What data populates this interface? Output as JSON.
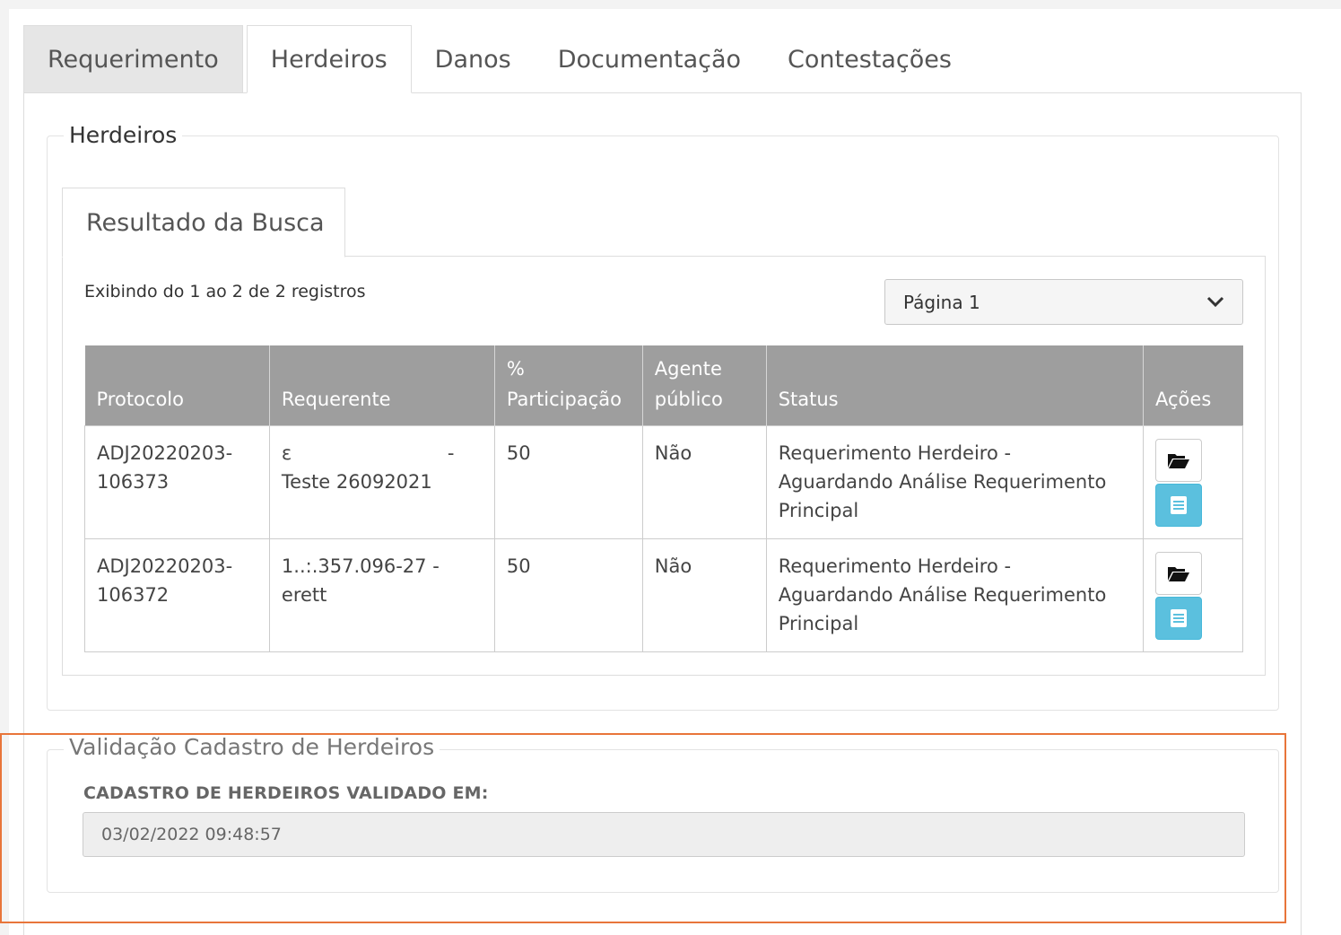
{
  "tabs": [
    {
      "label": "Requerimento"
    },
    {
      "label": "Herdeiros"
    },
    {
      "label": "Danos"
    },
    {
      "label": "Documentação"
    },
    {
      "label": "Contestações"
    }
  ],
  "active_tab": "Herdeiros",
  "herdeiros_section": {
    "legend": "Herdeiros",
    "subtab_label": "Resultado da Busca",
    "records_info": "Exibindo do 1 ao 2 de 2 registros",
    "page_select": {
      "selected": "Página 1"
    },
    "columns": [
      {
        "line1": "",
        "line2": "Protocolo"
      },
      {
        "line1": "",
        "line2": "Requerente"
      },
      {
        "line1": "%",
        "line2": "Participação"
      },
      {
        "line1": "Agente",
        "line2": "público"
      },
      {
        "line1": "",
        "line2": "Status"
      },
      {
        "line1": "",
        "line2": "Ações"
      }
    ],
    "rows": [
      {
        "protocolo": [
          "ADJ20220203-",
          "106373"
        ],
        "requerente": [
          "ε                          -",
          "Teste 26092021"
        ],
        "participacao": "50",
        "agente_publico": "Não",
        "status": [
          "Requerimento Herdeiro -",
          "Aguardando Análise Requerimento",
          "Principal"
        ]
      },
      {
        "protocolo": [
          "ADJ20220203-",
          "106372"
        ],
        "requerente": [
          "1..:.357.096-27 -",
          "erett"
        ],
        "participacao": "50",
        "agente_publico": "Não",
        "status": [
          "Requerimento Herdeiro -",
          "Aguardando Análise Requerimento",
          "Principal"
        ]
      }
    ],
    "action_icons": [
      "folder-open-icon",
      "list-detail-icon"
    ]
  },
  "validacao_section": {
    "legend": "Validação Cadastro de Herdeiros",
    "field_label": "CADASTRO DE HERDEIROS VALIDADO EM:",
    "field_value": "03/02/2022 09:48:57"
  },
  "colors": {
    "table_header_bg": "#9e9e9e",
    "detail_button_bg": "#5bc0de",
    "highlight_border": "#e8753a"
  }
}
